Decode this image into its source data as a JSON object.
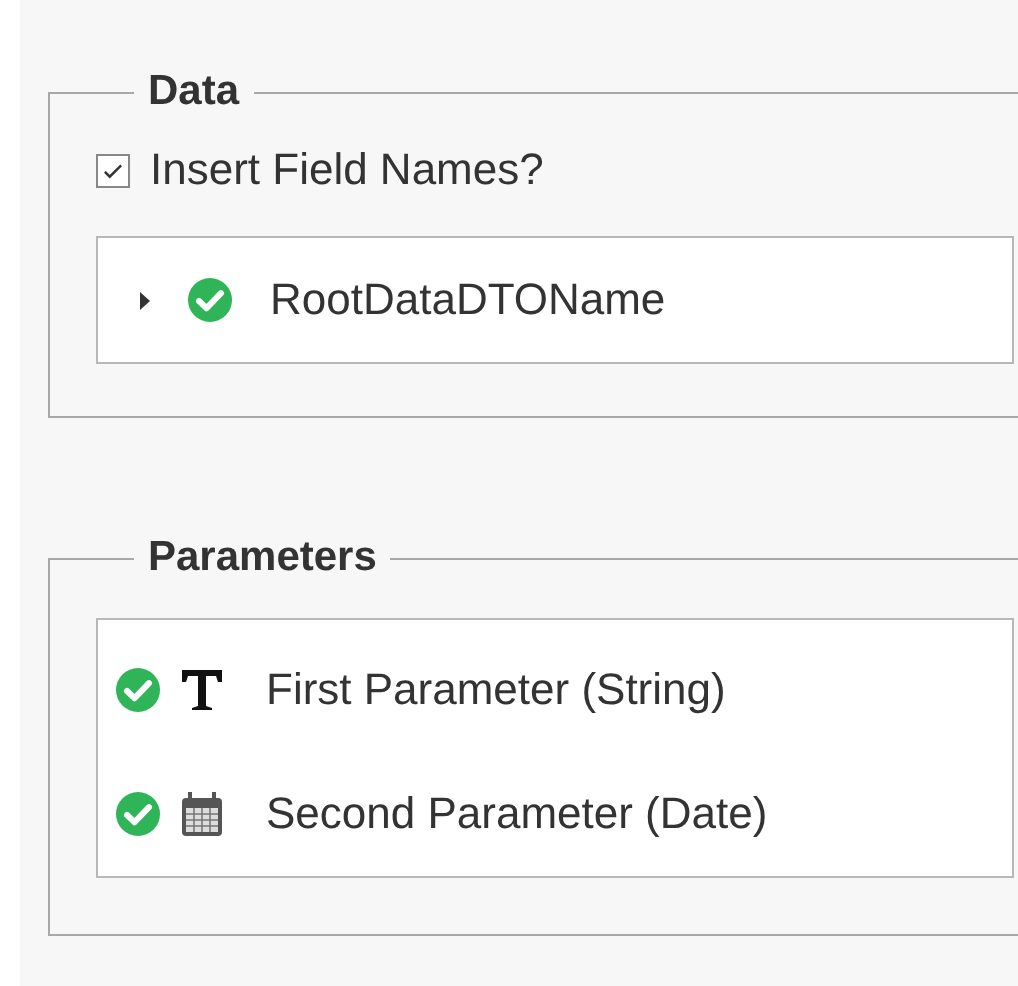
{
  "data_group": {
    "title": "Data",
    "insert_field_names": {
      "label": "Insert Field Names?",
      "checked": true
    },
    "tree": [
      {
        "label": "RootDataDTOName",
        "valid": true,
        "expanded": false
      }
    ]
  },
  "parameters_group": {
    "title": "Parameters",
    "items": [
      {
        "label": "First Parameter (String)",
        "valid": true,
        "kind": "string"
      },
      {
        "label": "Second Parameter (Date)",
        "valid": true,
        "kind": "date"
      }
    ]
  }
}
